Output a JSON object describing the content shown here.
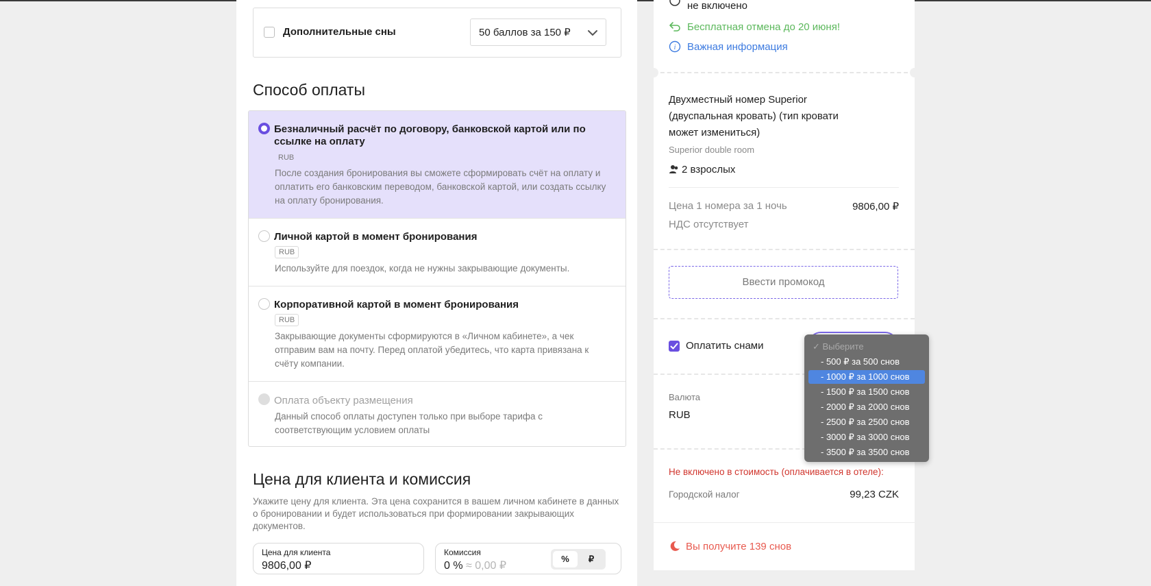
{
  "left": {
    "sleeps": {
      "label": "Дополнительные сны",
      "select_value": "50 баллов за 150 ₽"
    },
    "payment": {
      "title": "Способ оплаты",
      "options": [
        {
          "title": "Безналичный расчёт по договору, банковской картой или по ссылке на оплату",
          "currency": "RUB",
          "desc": "После создания бронирования вы сможете сформировать счёт на оплату и оплатить его банковским переводом, банковской картой, или создать ссылку на оплату бронирования.",
          "selected": true
        },
        {
          "title": "Личной картой в момент бронирования",
          "currency": "RUB",
          "desc": "Используйте для поездок, когда не нужны закрывающие документы.",
          "selected": false
        },
        {
          "title": "Корпоративной картой в момент бронирования",
          "currency": "RUB",
          "desc": "Закрывающие документы сформируются в «Личном кабинете», а чек отправим вам на почту. Перед оплатой убедитесь, что карта привязана к счёту компании.",
          "selected": false
        },
        {
          "title": "Оплата объекту размещения",
          "desc": "Данный способ оплаты доступен только при выборе тарифа с соответствующим условием оплаты",
          "disabled": true
        }
      ]
    },
    "price": {
      "title": "Цена для клиента и комиссия",
      "desc": "Укажите цену для клиента. Эта цена сохранится в вашем личном кабинете в данных о бронировании и будет использоваться при формировании закрывающих документов.",
      "client_price_label": "Цена для клиента",
      "client_price_value": "9806,00 ₽",
      "commission_label": "Комиссия",
      "commission_value": "0 %",
      "commission_approx": "≈ 0,00 ₽",
      "unit_percent": "%",
      "unit_rub": "₽"
    }
  },
  "right": {
    "not_included_top": "не включено",
    "free_cancel": "Бесплатная отмена до 20 июня!",
    "important_info": "Важная информация",
    "room_title_1": "Двухместный номер Superior",
    "room_title_2": "(двуспальная кровать) (тип кровати",
    "room_title_3": "может измениться)",
    "room_subtitle": "Superior double room",
    "guests": "2 взрослых",
    "price_label": "Цена 1 номера за 1 ночь",
    "price_value": "9806,00 ₽",
    "vat": "НДС отсутствует",
    "promo_button": "Ввести промокод",
    "pay_with_sleeps": "Оплатить снами",
    "currency_label": "Валюта",
    "currency_value": "RUB",
    "not_included_title": "Не включено в стоимость (оплачивается в отеле):",
    "city_tax_label": "Городской налог",
    "city_tax_value": "99,23 CZK",
    "earn_sleeps": "Вы получите 139 снов"
  },
  "dropdown": {
    "placeholder": "✓ Выберите",
    "options": [
      "- 500 ₽ за 500 снов",
      "- 1000 ₽ за 1000 снов",
      "- 1500 ₽ за 1500 снов",
      "- 2000 ₽ за 2000 снов",
      "- 2500 ₽ за 2500 снов",
      "- 3000 ₽ за 3000 снов",
      "- 3500 ₽ за 3500 снов"
    ],
    "highlighted_index": 1
  },
  "colors": {
    "accent": "#6a4fe0",
    "selected_bg": "#e5e0fb",
    "green": "#5cb85c",
    "link_blue": "#3d7be0",
    "red": "#d0342c",
    "earn_red": "#e85a4f",
    "dropdown_bg": "#6e6e6e",
    "dropdown_highlight": "#4f86e0"
  }
}
